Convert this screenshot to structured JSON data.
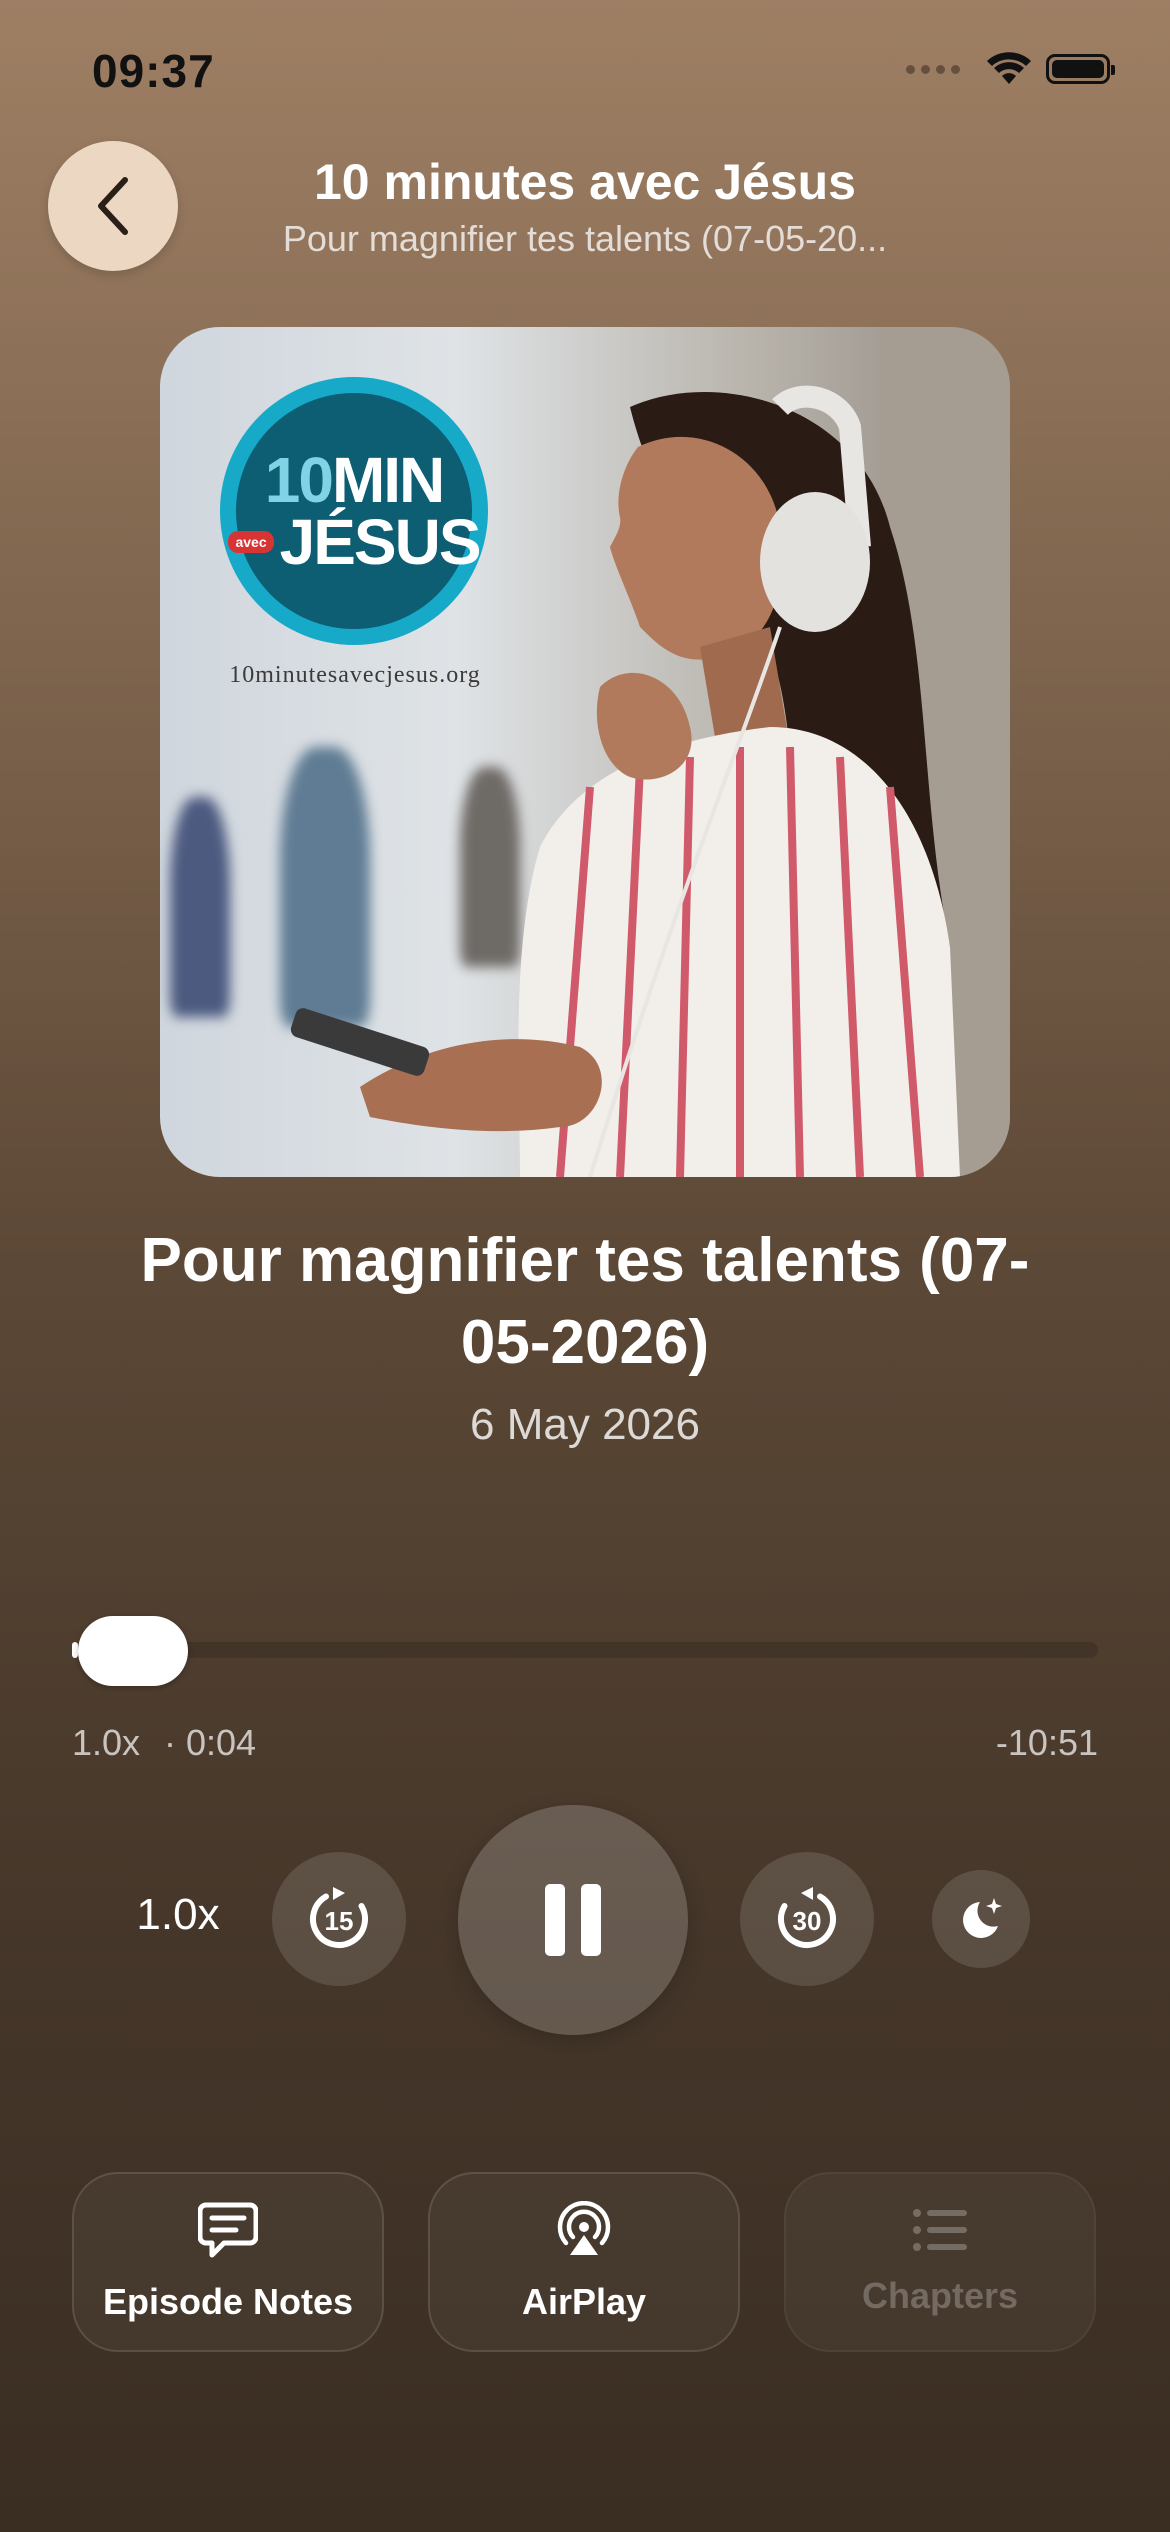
{
  "status": {
    "time": "09:37"
  },
  "header": {
    "title": "10 minutes avec Jésus",
    "subtitle": "Pour magnifier tes talents (07-05-20..."
  },
  "artwork": {
    "logo_number": "10",
    "logo_min": "MIN",
    "logo_avec": "avec",
    "logo_jesus": "JÉSUS",
    "logo_url": "10minutesavecjesus.org"
  },
  "episode": {
    "title": "Pour magnifier tes talents (07-05-2026)",
    "date": "6 May 2026"
  },
  "progress": {
    "rate": "1.0x",
    "elapsed": "· 0:04",
    "remaining": "-10:51",
    "fraction": 0.006
  },
  "controls": {
    "speed": "1.0x",
    "skip_back_seconds": "15",
    "skip_forward_seconds": "30"
  },
  "bottom": {
    "notes_label": "Episode Notes",
    "airplay_label": "AirPlay",
    "chapters_label": "Chapters"
  }
}
